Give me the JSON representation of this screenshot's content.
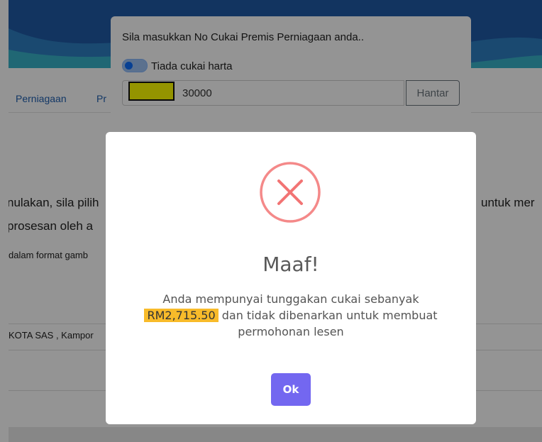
{
  "nav": {
    "items": [
      "Perniagaan",
      "Pr"
    ]
  },
  "content": {
    "line1_left": "nulakan, sila pilih",
    "line1_right": "untuk mer",
    "line2_left": "prosesan oleh a",
    "line3_left": "dalam format gamb",
    "address_left": "KOTA SAS , Kampor"
  },
  "tax_dialog": {
    "prompt": "Sila masukkan No Cukai Premis Perniagaan anda..",
    "toggle_label": "Tiada cukai harta",
    "input_value": "30000",
    "submit_label": "Hantar"
  },
  "alert": {
    "title": "Maaf!",
    "message_before": "Anda mempunyai tunggakan cukai sebanyak",
    "amount": "RM2,715.50",
    "message_after": "dan tidak dibenarkan untuk membuat permohonan lesen",
    "ok_label": "Ok"
  },
  "colors": {
    "error_icon": "#f27474",
    "amount_highlight": "#f8bb2a",
    "ok_button": "#7367f0",
    "redaction": "#ffff00"
  },
  "icons": {
    "alert_icon": "error-x-circle-icon"
  }
}
